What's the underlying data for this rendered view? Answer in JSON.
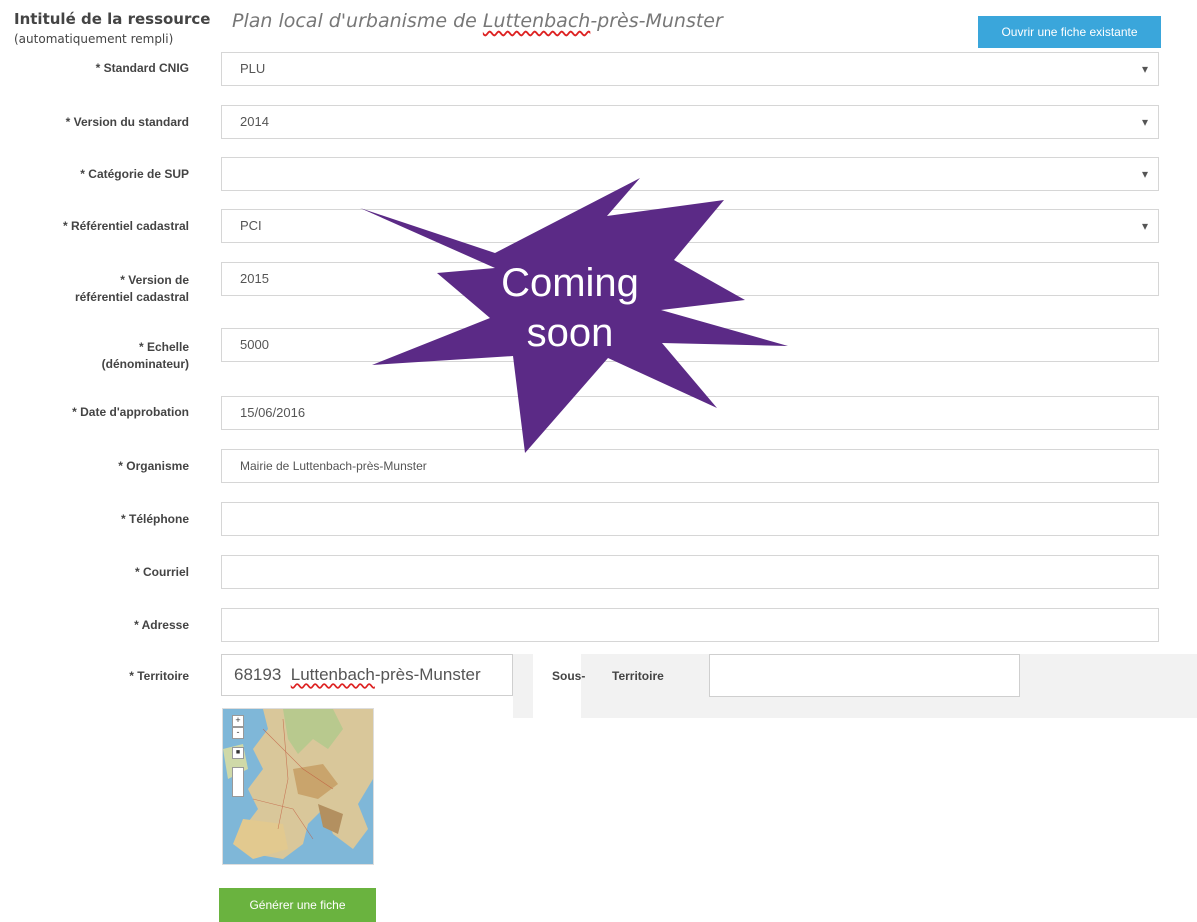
{
  "header": {
    "label": "Intitulé de la ressource",
    "sublabel": "(automatiquement rempli)",
    "value_pre": "Plan local d'urbanisme de ",
    "value_squiggle": "Luttenbach",
    "value_post": "-près-Munster",
    "open_button": "Ouvrir une fiche existante"
  },
  "fields": {
    "standard_cnig": {
      "label": "* Standard CNIG",
      "value": "PLU"
    },
    "version_standard": {
      "label": "* Version du standard",
      "value": "2014"
    },
    "categorie_sup": {
      "label": "* Catégorie de SUP",
      "value": ""
    },
    "referentiel_cadastral": {
      "label": "* Référentiel cadastral",
      "value": "PCI"
    },
    "version_referentiel": {
      "label_line1": "* Version de",
      "label_line2": "référentiel cadastral",
      "value": "2015"
    },
    "echelle": {
      "label_line1": "* Echelle",
      "label_line2": "(dénominateur)",
      "value": "5000"
    },
    "date_approbation": {
      "label": "* Date d'approbation",
      "value": "15/06/2016"
    },
    "organisme": {
      "label": "* Organisme",
      "value": "Mairie de Luttenbach-près-Munster"
    },
    "telephone": {
      "label": "* Téléphone",
      "value": ""
    },
    "courriel": {
      "label": "* Courriel",
      "value": ""
    },
    "adresse": {
      "label": "* Adresse",
      "value": ""
    },
    "territoire": {
      "label": "* Territoire",
      "code": "68193",
      "name_squiggle": "Luttenbach",
      "name_rest": "-près-Munster"
    }
  },
  "sous_territoire": {
    "label_part1": "Sous-",
    "label_part2": "Territoire",
    "value": ""
  },
  "map_controls": {
    "zoom_in": "+",
    "zoom_out": "-"
  },
  "generate_button": "Générer une fiche",
  "overlay": {
    "line1": "Coming",
    "line2": "soon"
  },
  "colors": {
    "open_button": "#3aa6db",
    "generate_button": "#6ab33f",
    "starburst": "#5b2a86"
  }
}
